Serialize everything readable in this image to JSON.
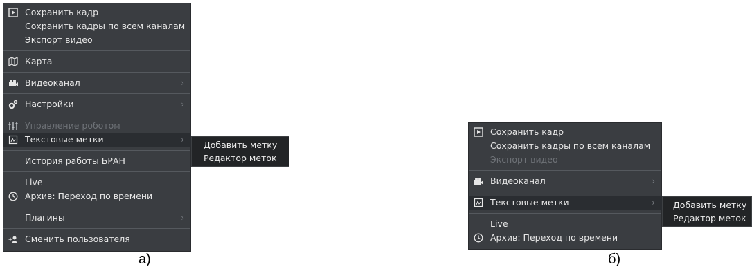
{
  "menu_a": {
    "items": [
      {
        "label": "Сохранить кадр",
        "icon": "play-frame-icon",
        "disabled": false,
        "submenu": false
      },
      {
        "label": "Сохранить кадры по всем каналам",
        "icon": "",
        "disabled": false,
        "submenu": false
      },
      {
        "label": "Экспорт видео",
        "icon": "",
        "disabled": false,
        "submenu": false
      },
      {
        "label": "Карта",
        "icon": "map-icon",
        "disabled": false,
        "submenu": false
      },
      {
        "label": "Видеоканал",
        "icon": "camera-icon",
        "disabled": false,
        "submenu": true
      },
      {
        "label": "Настройки",
        "icon": "gears-icon",
        "disabled": false,
        "submenu": true
      },
      {
        "label": "Управление роботом",
        "icon": "sliders-icon",
        "disabled": true,
        "submenu": false
      },
      {
        "label": "Текстовые метки",
        "icon": "text-label-icon",
        "disabled": false,
        "submenu": true,
        "highlighted": true
      },
      {
        "label": "История работы БРАН",
        "icon": "",
        "disabled": false,
        "submenu": false
      },
      {
        "label": "Live",
        "icon": "",
        "disabled": false,
        "submenu": false
      },
      {
        "label": "Архив: Переход по времени",
        "icon": "clock-icon",
        "disabled": false,
        "submenu": false
      },
      {
        "label": "Плагины",
        "icon": "",
        "disabled": false,
        "submenu": true
      },
      {
        "label": "Сменить пользователя",
        "icon": "switch-user-icon",
        "disabled": false,
        "submenu": false
      }
    ],
    "submenu": [
      "Добавить метку",
      "Редактор меток"
    ],
    "caption": "а)"
  },
  "menu_b": {
    "items": [
      {
        "label": "Сохранить кадр",
        "icon": "play-frame-icon",
        "disabled": false,
        "submenu": false
      },
      {
        "label": "Сохранить кадры по всем каналам",
        "icon": "",
        "disabled": false,
        "submenu": false
      },
      {
        "label": "Экспорт видео",
        "icon": "",
        "disabled": true,
        "submenu": false
      },
      {
        "label": "Видеоканал",
        "icon": "camera-icon",
        "disabled": false,
        "submenu": true
      },
      {
        "label": "Текстовые метки",
        "icon": "text-label-icon",
        "disabled": false,
        "submenu": true,
        "highlighted": true
      },
      {
        "label": "Live",
        "icon": "",
        "disabled": false,
        "submenu": false
      },
      {
        "label": "Архив: Переход по времени",
        "icon": "clock-icon",
        "disabled": false,
        "submenu": false
      }
    ],
    "submenu": [
      "Добавить метку",
      "Редактор меток"
    ],
    "caption": "б)"
  },
  "colors": {
    "menu_bg": "#3a3d41",
    "highlight": "#2a2d31",
    "text": "#e6e6e6",
    "disabled_text": "#6e7277",
    "submenu_bg": "#222426"
  }
}
